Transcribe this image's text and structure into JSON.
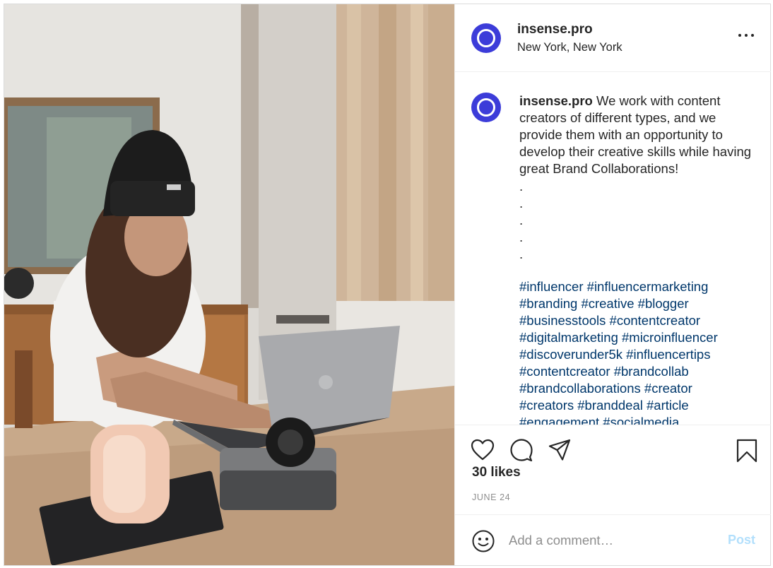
{
  "post": {
    "account": {
      "username": "insense.pro",
      "location": "New York, New York",
      "avatar_color": "#3c3cd9"
    },
    "photo": {
      "description_icon": "photo-woman-laptop-camera"
    },
    "caption": {
      "username": "insense.pro",
      "text": "We work with content creators of different types, and we provide them with an opportunity to develop their creative skills while having great Brand Collaborations!",
      "dots": [
        ".",
        ".",
        ".",
        ".",
        "."
      ],
      "hashtag_lines": [
        [
          "#influencer",
          "#influencermarketing"
        ],
        [
          "#branding",
          "#creative",
          "#blogger"
        ],
        [
          "#businesstools",
          "#contentcreator"
        ],
        [
          "#digitalmarketing",
          "#microinfluencer"
        ],
        [
          "#discoverunder5k",
          "#influencertips"
        ],
        [
          "#contentcreator",
          "#brandcollab"
        ],
        [
          "#brandcollaborations",
          "#creator"
        ],
        [
          "#creators",
          "#branddeal",
          "#article"
        ],
        [
          "#engagement",
          "#socialmedia"
        ]
      ]
    },
    "likes": "30 likes",
    "date": "JUNE 24",
    "comment": {
      "placeholder": "Add a comment…",
      "post_label": "Post"
    },
    "icons": {
      "more": "more-options-icon",
      "like": "heart-icon",
      "comment": "comment-icon",
      "share": "share-icon",
      "save": "bookmark-icon",
      "emoji": "emoji-icon"
    },
    "colors": {
      "hashtag": "#00376b",
      "post_button_disabled": "#b2dffc",
      "meta_gray": "#8e8e8e"
    }
  }
}
